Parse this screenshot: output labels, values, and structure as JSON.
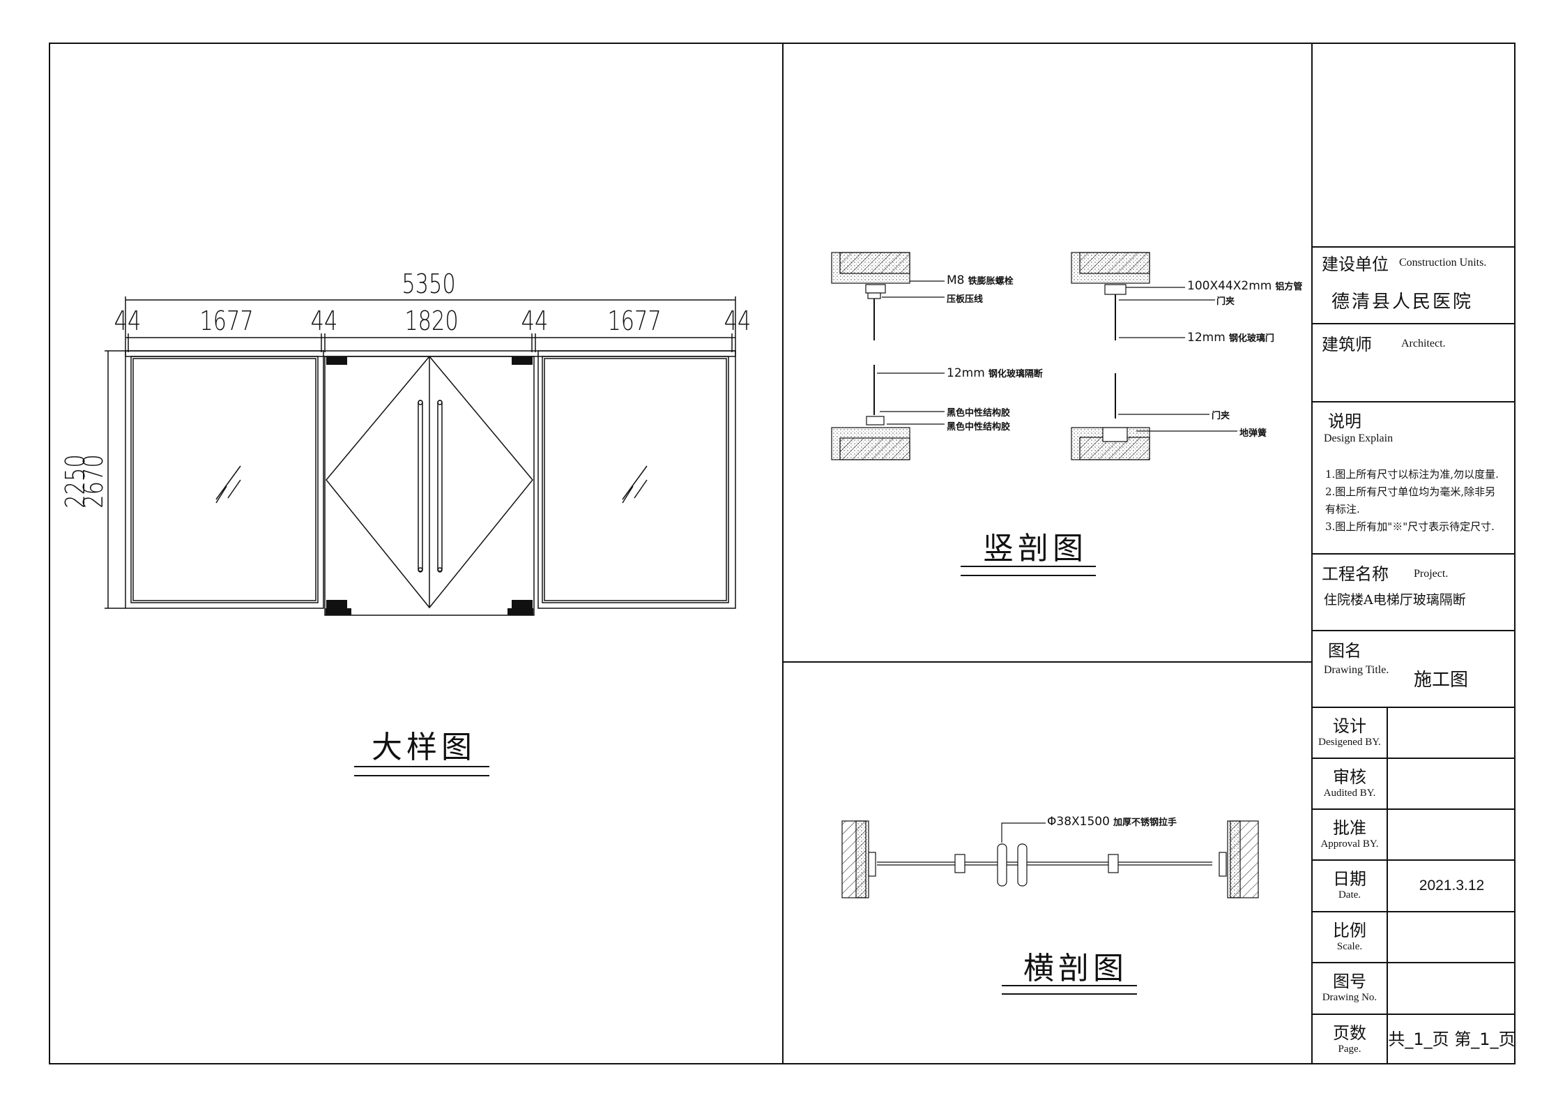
{
  "detail_view": {
    "caption": "大样图",
    "dims_top_total": "5350",
    "dims_top_parts": [
      "44",
      "1677",
      "44",
      "1820",
      "44",
      "1677",
      "44"
    ],
    "dims_left": [
      "2250",
      "2670"
    ]
  },
  "vertical_section": {
    "caption": "竖剖图",
    "top_left_notes": [
      {
        "num": "M8",
        "text": "铁膨胀螺栓"
      },
      {
        "num": "",
        "text": "压板压线"
      }
    ],
    "top_right_notes": [
      {
        "num": "100X44X2mm",
        "text": "铝方管"
      },
      {
        "num": "",
        "text": "门夹"
      },
      {
        "num": "12mm",
        "text": "钢化玻璃门"
      }
    ],
    "bottom_left_notes": [
      {
        "num": "12mm",
        "text": "钢化玻璃隔断"
      },
      {
        "num": "",
        "text": "黑色中性结构胶"
      },
      {
        "num": "",
        "text": "黑色中性结构胶"
      }
    ],
    "bottom_right_notes": [
      {
        "num": "",
        "text": "门夹"
      },
      {
        "num": "",
        "text": "地弹簧"
      }
    ]
  },
  "horizontal_section": {
    "caption": "横剖图",
    "handle_note_num": "Φ38X1500",
    "handle_note_text": "加厚不锈钢拉手"
  },
  "title_block": {
    "construction_units_cn": "建设单位",
    "construction_units_en": "Construction Units.",
    "construction_units_value": "德清县人民医院",
    "architect_cn": "建筑师",
    "architect_en": "Architect.",
    "design_explain_cn": "说明",
    "design_explain_en": "Design Explain",
    "design_notes": [
      "1.图上所有尺寸以标注为准,勿以度量.",
      "2.图上所有尺寸单位均为毫米,除非另",
      "有标注.",
      "3.图上所有加\"※\"尺寸表示待定尺寸."
    ],
    "project_cn": "工程名称",
    "project_en": "Project.",
    "project_value": "住院楼A电梯厅玻璃隔断",
    "drawing_title_cn": "图名",
    "drawing_title_en": "Drawing Title.",
    "drawing_title_value": "施工图",
    "rows": [
      {
        "cn": "设计",
        "en": "Desigened BY.",
        "value": ""
      },
      {
        "cn": "审核",
        "en": "Audited BY.",
        "value": ""
      },
      {
        "cn": "批准",
        "en": "Approval BY.",
        "value": ""
      },
      {
        "cn": "日期",
        "en": "Date.",
        "value": "2021.3.12"
      },
      {
        "cn": "比例",
        "en": "Scale.",
        "value": ""
      },
      {
        "cn": "图号",
        "en": "Drawing No.",
        "value": ""
      },
      {
        "cn": "页数",
        "en": "Page.",
        "value": "共_1_页 第_1_页"
      }
    ]
  }
}
